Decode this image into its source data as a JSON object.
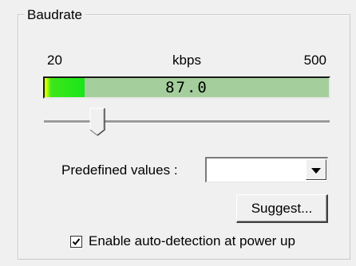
{
  "group": {
    "title": "Baudrate"
  },
  "range": {
    "min": "20",
    "unit": "kbps",
    "max": "500"
  },
  "meter": {
    "value_text": "87.0",
    "fill_fraction": 0.14
  },
  "slider": {
    "position_fraction": 0.14
  },
  "predefined": {
    "label": "Predefined values :",
    "selected": ""
  },
  "suggest_button": {
    "label": "Suggest..."
  },
  "autodetect": {
    "label": "Enable auto-detection at power up",
    "checked": true
  }
}
